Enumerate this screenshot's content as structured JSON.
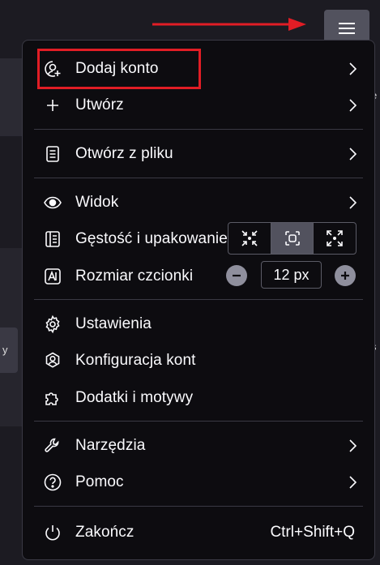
{
  "toolbar": {
    "menu_icon": "hamburger-menu-icon"
  },
  "menu": {
    "items": [
      {
        "label": "Dodaj konto",
        "icon": "add-account-icon",
        "submenu": true
      },
      {
        "label": "Utwórz",
        "icon": "plus-icon",
        "submenu": true
      },
      {
        "label": "Otwórz z pliku",
        "icon": "open-file-icon",
        "submenu": true
      },
      {
        "label": "Widok",
        "icon": "eye-icon",
        "submenu": true
      },
      {
        "label": "Gęstość i upakowanie",
        "icon": "density-icon",
        "submenu": false
      },
      {
        "label": "Rozmiar czcionki",
        "icon": "font-size-icon",
        "submenu": false
      },
      {
        "label": "Ustawienia",
        "icon": "gear-icon",
        "submenu": false
      },
      {
        "label": "Konfiguracja kont",
        "icon": "account-settings-icon",
        "submenu": false
      },
      {
        "label": "Dodatki i motywy",
        "icon": "puzzle-icon",
        "submenu": false
      },
      {
        "label": "Narzędzia",
        "icon": "wrench-icon",
        "submenu": true
      },
      {
        "label": "Pomoc",
        "icon": "help-icon",
        "submenu": true
      },
      {
        "label": "Zakończ",
        "icon": "power-icon",
        "shortcut": "Ctrl+Shift+Q"
      }
    ],
    "density": {
      "options": [
        "compact",
        "normal",
        "touch"
      ],
      "selected": "normal"
    },
    "font_size": {
      "value": "12 px"
    }
  },
  "colors": {
    "highlight": "#e11d25",
    "menu_bg": "#0d0c10",
    "text": "#fbfbfe"
  }
}
